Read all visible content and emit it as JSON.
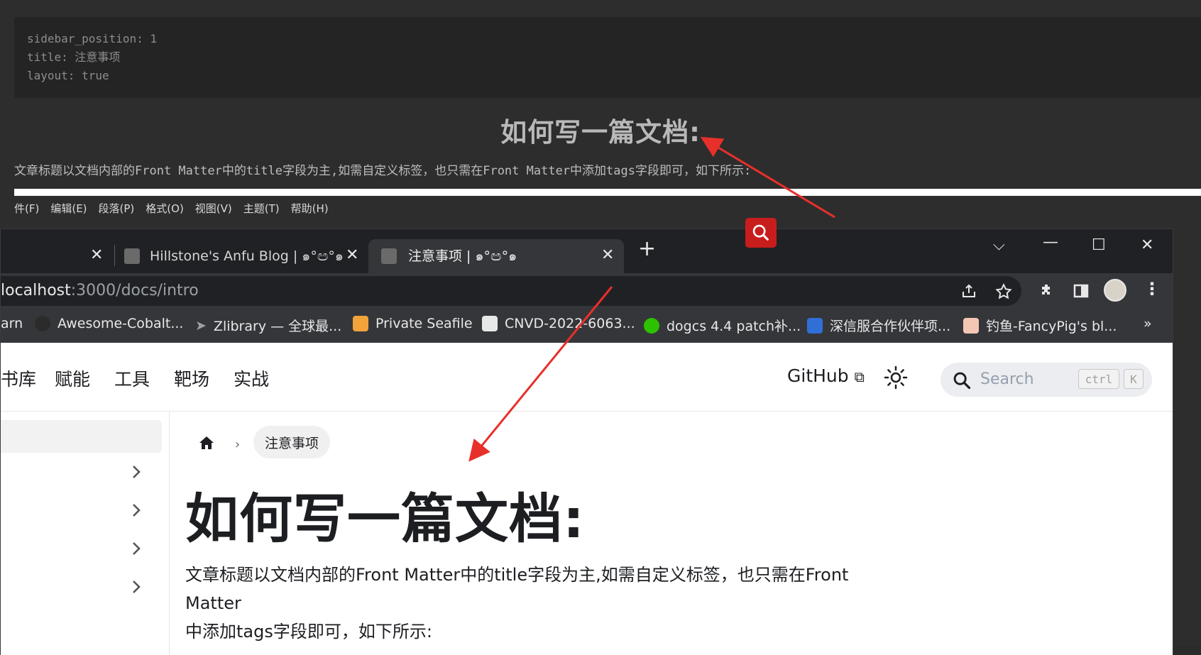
{
  "editor": {
    "code_lines": [
      "sidebar_position: 1",
      "title: 注意事项",
      "layout: true"
    ],
    "heading": "如何写一篇文档:",
    "paragraph": "文章标题以文档内部的Front Matter中的title字段为主,如需自定义标签，也只需在Front Matter中添加tags字段即可，如下所示:",
    "menu": [
      "件(F)",
      "编辑(E)",
      "段落(P)",
      "格式(O)",
      "视图(V)",
      "主题(T)",
      "帮助(H)"
    ],
    "search_fab_icon": "search-icon",
    "fab_color": "#c81d1d"
  },
  "browser": {
    "tabs": [
      {
        "title": "Hillstone's Anfu Blog | ๑°ඏ°๑",
        "active": false
      },
      {
        "title": "注意事项 | ๑°ඏ°๑",
        "active": true
      }
    ],
    "new_tab_label": "+",
    "url_host": "localhost",
    "url_rest": ":3000/docs/intro",
    "bookmarks": [
      {
        "label": "arn",
        "icon": "none"
      },
      {
        "label": "Awesome-Cobalt...",
        "icon": "github-icon"
      },
      {
        "label": "Zlibrary — 全球最...",
        "icon": "arrow-icon"
      },
      {
        "label": "Private Seafile",
        "icon": "seafile-icon"
      },
      {
        "label": "CNVD-2022-6063...",
        "icon": "cnvd-icon"
      },
      {
        "label": "dogcs 4.4 patch补...",
        "icon": "wechat-icon"
      },
      {
        "label": "深信服合作伙伴项...",
        "icon": "shield-icon"
      },
      {
        "label": "钓鱼-FancyPig's bl...",
        "icon": "pig-icon"
      }
    ],
    "bookmarks_more": "»"
  },
  "site": {
    "nav_links": [
      "书库",
      "赋能",
      "工具",
      "靶场",
      "实战"
    ],
    "github_label": "GitHub",
    "search_placeholder": "Search",
    "kbd_ctrl": "ctrl",
    "kbd_k": "K",
    "breadcrumb_current": "注意事项",
    "title": "如何写一篇文档:",
    "body_line1": "文章标题以文档内部的Front Matter中的title字段为主,如需自定义标签，也只需在Front Matter",
    "body_line2": "中添加tags字段即可，如下所示:"
  },
  "colors": {
    "annotation_arrow": "#e8302a",
    "chrome_dark": "#202124",
    "chrome_toolbar": "#35363a"
  }
}
